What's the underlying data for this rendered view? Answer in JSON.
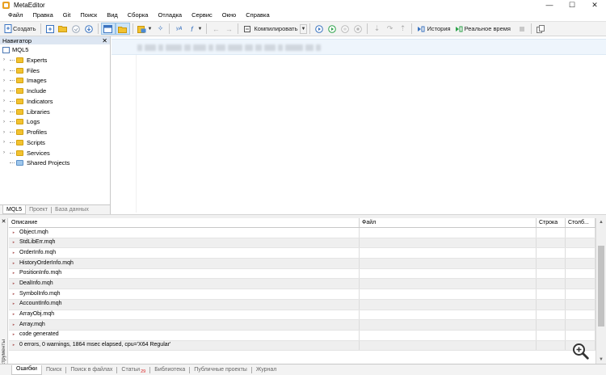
{
  "window": {
    "title": "MetaEditor",
    "controls": [
      "—",
      "☐",
      "✕"
    ]
  },
  "menu": [
    "Файл",
    "Правка",
    "Git",
    "Поиск",
    "Вид",
    "Сборка",
    "Отладка",
    "Сервис",
    "Окно",
    "Справка"
  ],
  "toolbar": {
    "create_label": "Создать",
    "compile_label": "Компилировать",
    "history_label": "История",
    "realtime_label": "Реальное время"
  },
  "navigator": {
    "title": "Навигатор",
    "root": "MQL5",
    "items": [
      "Experts",
      "Files",
      "Images",
      "Include",
      "Indicators",
      "Libraries",
      "Logs",
      "Profiles",
      "Scripts",
      "Services",
      "Shared Projects"
    ],
    "tabs": [
      "MQL5",
      "Проект",
      "База данных"
    ]
  },
  "toolbox": {
    "side_label": "Инструменты",
    "columns": [
      "Описание",
      "Файл",
      "Строка",
      "Столб..."
    ],
    "rows": [
      {
        "description": "Object.mqh",
        "icon": "info-icon"
      },
      {
        "description": "StdLibErr.mqh",
        "icon": "info-icon"
      },
      {
        "description": "OrderInfo.mqh",
        "icon": "info-icon"
      },
      {
        "description": "HistoryOrderInfo.mqh",
        "icon": "info-icon"
      },
      {
        "description": "PositionInfo.mqh",
        "icon": "info-icon"
      },
      {
        "description": "DealInfo.mqh",
        "icon": "info-icon"
      },
      {
        "description": "SymbolInfo.mqh",
        "icon": "info-icon"
      },
      {
        "description": "AccountInfo.mqh",
        "icon": "info-icon"
      },
      {
        "description": "ArrayObj.mqh",
        "icon": "info-icon"
      },
      {
        "description": "Array.mqh",
        "icon": "info-icon"
      },
      {
        "description": "code generated",
        "icon": "info-icon"
      },
      {
        "description": "0 errors, 0 warnings, 1864 msec elapsed, cpu='X64 Regular'",
        "icon": "info-icon"
      }
    ],
    "tabs": [
      "Ошибки",
      "Поиск",
      "Поиск в файлах",
      "Статьи",
      "Библиотека",
      "Публичные проекты",
      "Журнал"
    ],
    "articles_badge": "29"
  }
}
